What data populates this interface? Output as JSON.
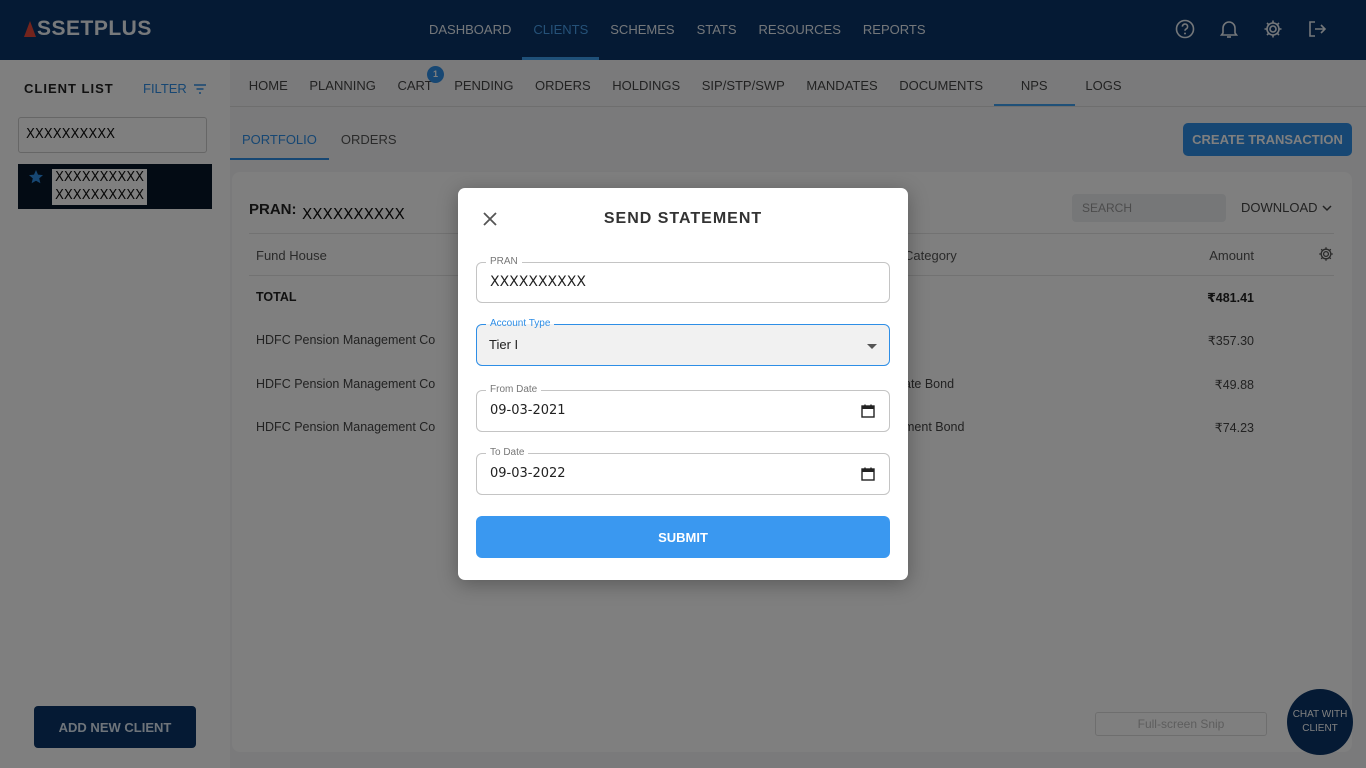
{
  "brand": {
    "logo_rest": "SSETPLUS"
  },
  "topnav": [
    {
      "label": "DASHBOARD",
      "active": false
    },
    {
      "label": "CLIENTS",
      "active": true
    },
    {
      "label": "SCHEMES",
      "active": false
    },
    {
      "label": "STATS",
      "active": false
    },
    {
      "label": "RESOURCES",
      "active": false
    },
    {
      "label": "REPORTS",
      "active": false
    }
  ],
  "topicons": [
    "help-icon",
    "bell-icon",
    "gear-icon",
    "logout-icon"
  ],
  "sidebar": {
    "title": "CLIENT LIST",
    "filter_label": "FILTER",
    "search_value": "XXXXXXXXXX",
    "client": {
      "line1": "XXXXXXXXXX",
      "line2": "XXXXXXXXXX"
    },
    "add_button": "ADD NEW CLIENT"
  },
  "subnav": [
    {
      "label": "HOME"
    },
    {
      "label": "PLANNING"
    },
    {
      "label": "CART"
    },
    {
      "label": "PENDING"
    },
    {
      "label": "ORDERS"
    },
    {
      "label": "HOLDINGS"
    },
    {
      "label": "SIP/STP/SWP"
    },
    {
      "label": "MANDATES"
    },
    {
      "label": "DOCUMENTS"
    },
    {
      "label": "NPS"
    },
    {
      "label": "LOGS"
    }
  ],
  "cart_badge": "1",
  "portfolio_tabs": [
    {
      "label": "PORTFOLIO"
    },
    {
      "label": "ORDERS"
    }
  ],
  "create_button": "CREATE TRANSACTION",
  "card": {
    "pran_label": "PRAN:",
    "pran_value": "XXXXXXXXXX",
    "search_placeholder": "SEARCH",
    "download_label": "DOWNLOAD",
    "headers": {
      "fund_house": "Fund House",
      "category": "Category",
      "amount": "Amount"
    },
    "rows": [
      {
        "fund_house": "TOTAL",
        "category": "",
        "amount": "₹481.41"
      },
      {
        "fund_house": "HDFC Pension Management Compan",
        "category": "",
        "amount": "₹357.30"
      },
      {
        "fund_house": "HDFC Pension Management Compan",
        "category": "ate Bond",
        "amount": "₹49.88"
      },
      {
        "fund_house": "HDFC Pension Management Compan",
        "category": "ment Bond",
        "amount": "₹74.23"
      }
    ]
  },
  "snip_label": "Full-screen Snip",
  "chat": {
    "line1": "CHAT WITH",
    "line2": "CLIENT"
  },
  "modal": {
    "title": "SEND STATEMENT",
    "pran_label": "PRAN",
    "pran_value": "XXXXXXXXXX",
    "account_label": "Account Type",
    "account_value": "Tier I",
    "from_label": "From Date",
    "from_value": "09-03-2021",
    "to_label": "To Date",
    "to_value": "09-03-2022",
    "submit_label": "SUBMIT"
  },
  "colors": {
    "primary": "#0a3568",
    "accent": "#2e8ee6",
    "submit": "#3a98f0"
  }
}
